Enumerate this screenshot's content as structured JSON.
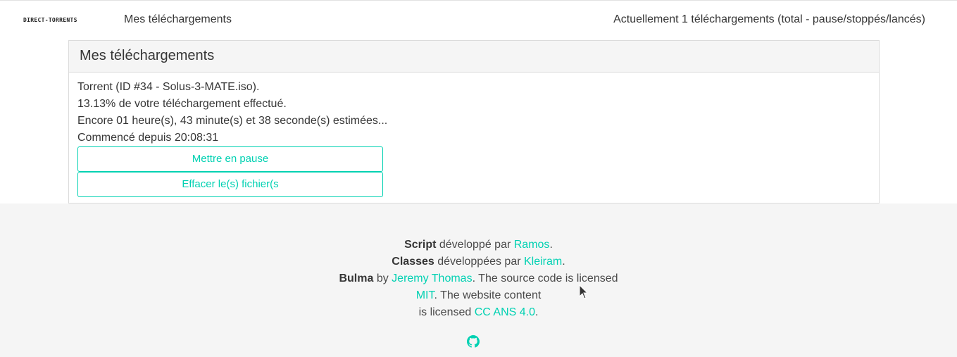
{
  "navbar": {
    "brand": "DIRECT-TORRENTS",
    "title": "Mes téléchargements",
    "status": "Actuellement 1 téléchargements (total - pause/stoppés/lancés)"
  },
  "panel": {
    "heading": "Mes téléchargements",
    "torrent_line": "Torrent (ID #34 - Solus-3-MATE.iso).",
    "progress_line": "13.13% de votre téléchargement effectué.",
    "remaining_line": "Encore 01 heure(s), 43 minute(s) et 38 seconde(s) estimées...",
    "started_line": "Commencé depuis 20:08:31",
    "pause_button": "Mettre en pause",
    "delete_button": "Effacer le(s) fichier(s"
  },
  "footer": {
    "line1": {
      "strong": "Script",
      "text": " développé par ",
      "link": "Ramos",
      "after": "."
    },
    "line2": {
      "strong": "Classes",
      "text": " développées par ",
      "link": "Kleiram",
      "after": "."
    },
    "line3": {
      "strong": "Bulma",
      "text": " by ",
      "link": "Jeremy Thomas",
      "after": ". The source code is licensed"
    },
    "line4": {
      "link": "MIT",
      "after": ". The website content"
    },
    "line5": {
      "text": "is licensed ",
      "link": "CC ANS 4.0",
      "after": "."
    },
    "icon": "github-icon"
  },
  "colors": {
    "accent": "#00d1b2",
    "footer_bg": "#f5f5f5",
    "text": "#4a4a4a"
  }
}
